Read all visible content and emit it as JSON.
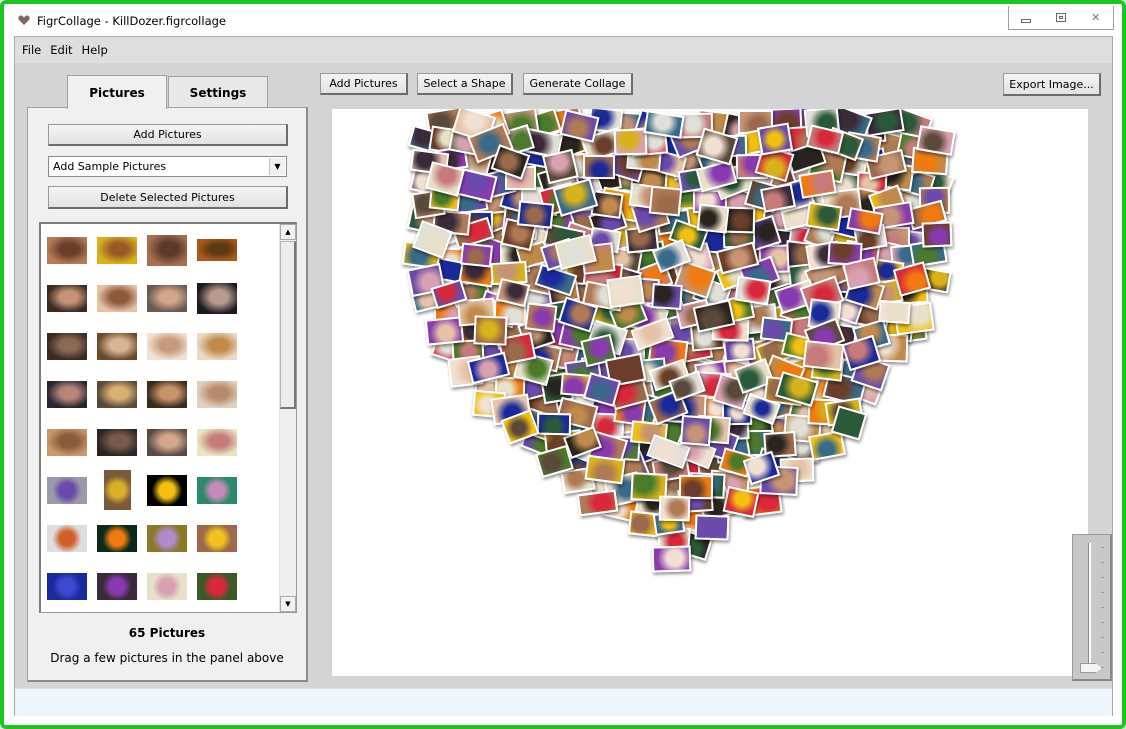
{
  "window": {
    "title": "FigrCollage - KillDozer.figrcollage",
    "icon": "heart-icon",
    "controls": {
      "minimize": "▭",
      "restore": "⧉",
      "close": "✕"
    },
    "frame_color": "#1ec51e"
  },
  "menu": [
    "File",
    "Edit",
    "Help"
  ],
  "left_panel": {
    "tabs": [
      {
        "label": "Pictures",
        "active": true
      },
      {
        "label": "Settings",
        "active": false
      }
    ],
    "add_pictures_label": "Add Pictures",
    "sample_select": {
      "value": "Add Sample Pictures",
      "arrow": "▼"
    },
    "delete_label": "Delete Selected Pictures",
    "thumbnails": [
      {
        "subject": "portrait",
        "colors": [
          "#b77a55",
          "#6a3e2a"
        ],
        "aspect": "landscape"
      },
      {
        "subject": "portrait",
        "colors": [
          "#d9b21a",
          "#9a5a28"
        ],
        "aspect": "landscape"
      },
      {
        "subject": "portrait",
        "colors": [
          "#a87050",
          "#5c3a2a"
        ],
        "aspect": "square"
      },
      {
        "subject": "portrait",
        "colors": [
          "#b0581a",
          "#5a3a12"
        ],
        "aspect": "wide"
      },
      {
        "subject": "portrait",
        "colors": [
          "#3b2a20",
          "#c59475"
        ],
        "aspect": "landscape"
      },
      {
        "subject": "portrait",
        "colors": [
          "#e6c2a8",
          "#8c5a3a"
        ],
        "aspect": "landscape"
      },
      {
        "subject": "portrait",
        "colors": [
          "#6a5a52",
          "#d3a58a"
        ],
        "aspect": "landscape"
      },
      {
        "subject": "portrait",
        "colors": [
          "#1c1a1e",
          "#b89a8e"
        ],
        "aspect": "square"
      },
      {
        "subject": "portrait",
        "colors": [
          "#3a2a22",
          "#8a6a55"
        ],
        "aspect": "landscape"
      },
      {
        "subject": "portrait",
        "colors": [
          "#6a4a2a",
          "#d9b595"
        ],
        "aspect": "landscape"
      },
      {
        "subject": "portrait",
        "colors": [
          "#f2e0d2",
          "#c69a7a"
        ],
        "aspect": "landscape"
      },
      {
        "subject": "portrait",
        "colors": [
          "#e9d9c5",
          "#c08a4a"
        ],
        "aspect": "landscape"
      },
      {
        "subject": "portrait",
        "colors": [
          "#2a2430",
          "#b6857a"
        ],
        "aspect": "landscape"
      },
      {
        "subject": "portrait",
        "colors": [
          "#5a4a3a",
          "#d8b070"
        ],
        "aspect": "landscape"
      },
      {
        "subject": "portrait",
        "colors": [
          "#3a2a1a",
          "#c9936a"
        ],
        "aspect": "landscape"
      },
      {
        "subject": "portrait",
        "colors": [
          "#e0d0c0",
          "#b88a6a"
        ],
        "aspect": "landscape"
      },
      {
        "subject": "portrait",
        "colors": [
          "#c89a6a",
          "#8a5a3a"
        ],
        "aspect": "landscape"
      },
      {
        "subject": "portrait",
        "colors": [
          "#2a2624",
          "#7a5a4a"
        ],
        "aspect": "landscape"
      },
      {
        "subject": "portrait",
        "colors": [
          "#5a4a44",
          "#d4a58c"
        ],
        "aspect": "landscape"
      },
      {
        "subject": "portrait",
        "colors": [
          "#e8e6c0",
          "#c67a7a"
        ],
        "aspect": "landscape"
      },
      {
        "subject": "flower",
        "colors": [
          "#9a9aa8",
          "#6a4aaa"
        ],
        "aspect": "landscape"
      },
      {
        "subject": "flower",
        "colors": [
          "#7a5a3a",
          "#d8b02a"
        ],
        "aspect": "tall"
      },
      {
        "subject": "flower",
        "colors": [
          "#000000",
          "#f2c011"
        ],
        "aspect": "square"
      },
      {
        "subject": "flower",
        "colors": [
          "#2a8a6a",
          "#c58ab8"
        ],
        "aspect": "landscape"
      },
      {
        "subject": "flower",
        "colors": [
          "#dedede",
          "#d0602a"
        ],
        "aspect": "landscape"
      },
      {
        "subject": "flower",
        "colors": [
          "#0a2a1a",
          "#f07a10"
        ],
        "aspect": "landscape"
      },
      {
        "subject": "flower",
        "colors": [
          "#8a7a2a",
          "#b08ad0"
        ],
        "aspect": "landscape"
      },
      {
        "subject": "flower",
        "colors": [
          "#9a6a4a",
          "#f2c020"
        ],
        "aspect": "landscape"
      },
      {
        "subject": "flower",
        "colors": [
          "#1a2a9a",
          "#3a4ad0"
        ],
        "aspect": "landscape"
      },
      {
        "subject": "flower",
        "colors": [
          "#3a2a3a",
          "#8a3ab0"
        ],
        "aspect": "landscape"
      },
      {
        "subject": "flower",
        "colors": [
          "#e8e0c8",
          "#d8a0b0"
        ],
        "aspect": "landscape"
      },
      {
        "subject": "flower",
        "colors": [
          "#3a5a2a",
          "#d8283a"
        ],
        "aspect": "landscape"
      }
    ],
    "scroll": {
      "up": "▲",
      "down": "▼",
      "position_fraction": 0.0
    },
    "count_label": "65 Pictures",
    "hint": "Drag a few pictures in the panel above"
  },
  "toolbar": {
    "add_pictures": "Add Pictures",
    "select_shape": "Select a Shape",
    "generate_collage": "Generate Collage",
    "export_image": "Export Image..."
  },
  "collage": {
    "shape": "heart",
    "palette": [
      "#b07a55",
      "#d8b21a",
      "#6a3e2a",
      "#2a2420",
      "#c59475",
      "#e6c2a8",
      "#6a4aaa",
      "#f2c011",
      "#1a2a9a",
      "#8a3ab0",
      "#d8283a",
      "#f07a10",
      "#2a5a3a",
      "#e8e0c8",
      "#3a6a8a",
      "#c08a4a",
      "#f2e0d2",
      "#d8a0b0",
      "#5a4a3a",
      "#e0e0d8",
      "#9a6a4a",
      "#3a2a3a",
      "#c67a7a",
      "#4a7a2a"
    ]
  },
  "zoom_slider": {
    "value_fraction": 0.0,
    "ticks": 9
  }
}
